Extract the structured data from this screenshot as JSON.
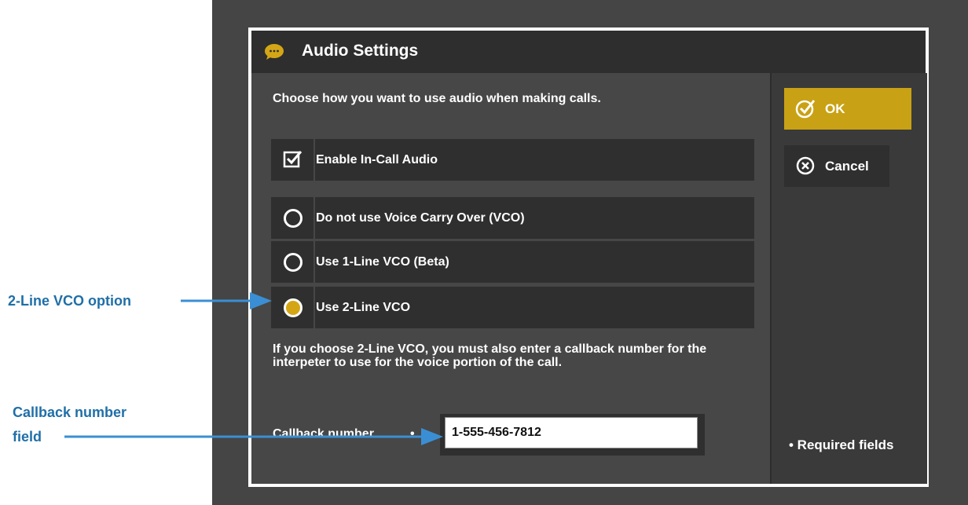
{
  "dialog": {
    "title": "Audio Settings",
    "intro": "Choose how you want to use audio when making calls.",
    "enable_audio_label": "Enable In-Call Audio",
    "enable_audio_checked": true,
    "options": [
      {
        "label": "Do not use Voice Carry Over (VCO)",
        "selected": false
      },
      {
        "label": "Use 1-Line VCO (Beta)",
        "selected": false
      },
      {
        "label": "Use 2-Line VCO",
        "selected": true
      }
    ],
    "help_text": "If you choose 2-Line VCO, you must also enter a callback number for the interpeter to use for the voice portion of the call.",
    "callback_label": "Callback number",
    "required_marker": "•",
    "callback_value": "1-555-456-7812",
    "ok_label": "OK",
    "cancel_label": "Cancel",
    "required_note": "• Required fields"
  },
  "annotations": {
    "vco_option": "2-Line VCO option",
    "callback_line1": "Callback number",
    "callback_line2": "field"
  },
  "colors": {
    "accent": "#c9a114",
    "callout": "#1f6fa8",
    "arrow": "#3a8fd4"
  },
  "icons": [
    "speech-bubble-icon",
    "checkbox-checked-icon",
    "check-circle-icon",
    "x-circle-icon"
  ]
}
